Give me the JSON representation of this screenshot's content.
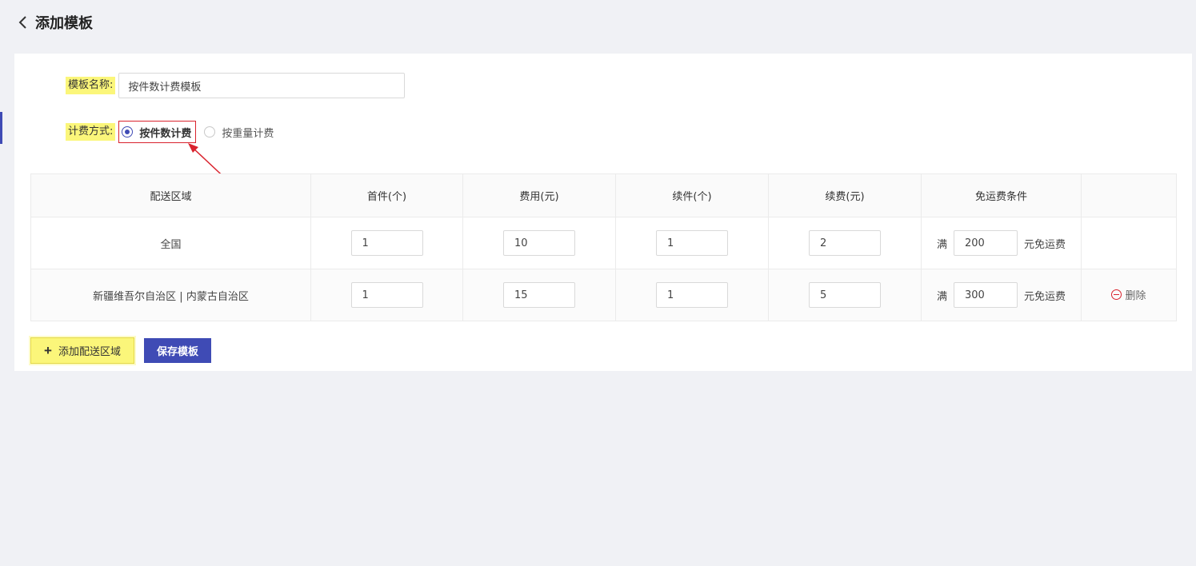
{
  "header": {
    "title": "添加模板"
  },
  "form": {
    "name_label": "模板名称:",
    "name_value": "按件数计费模板",
    "billing_label": "计费方式:",
    "billing_options": [
      "按件数计费",
      "按重量计费"
    ],
    "billing_selected": "按件数计费"
  },
  "table": {
    "headers": [
      "配送区域",
      "首件(个)",
      "费用(元)",
      "续件(个)",
      "续费(元)",
      "免运费条件",
      ""
    ],
    "rows": [
      {
        "region": "全国",
        "first": "1",
        "fee": "10",
        "additional": "1",
        "additional_fee": "2",
        "free_prefix": "满",
        "free_amount": "200",
        "free_suffix": "元免运费",
        "delete": ""
      },
      {
        "region": "新疆维吾尔自治区 | 内蒙古自治区",
        "first": "1",
        "fee": "15",
        "additional": "1",
        "additional_fee": "5",
        "free_prefix": "满",
        "free_amount": "300",
        "free_suffix": "元免运费",
        "delete": "删除"
      }
    ]
  },
  "actions": {
    "add_label": "添加配送区域",
    "save_label": "保存模板"
  },
  "colors": {
    "primary": "#3f4bb5",
    "highlight": "#fbf67a",
    "annotation_red": "#d9232e",
    "page_bg": "#f0f1f5"
  },
  "icons": {
    "back": "chevron-left-icon",
    "plus": "plus-icon",
    "delete": "minus-circle-icon"
  }
}
